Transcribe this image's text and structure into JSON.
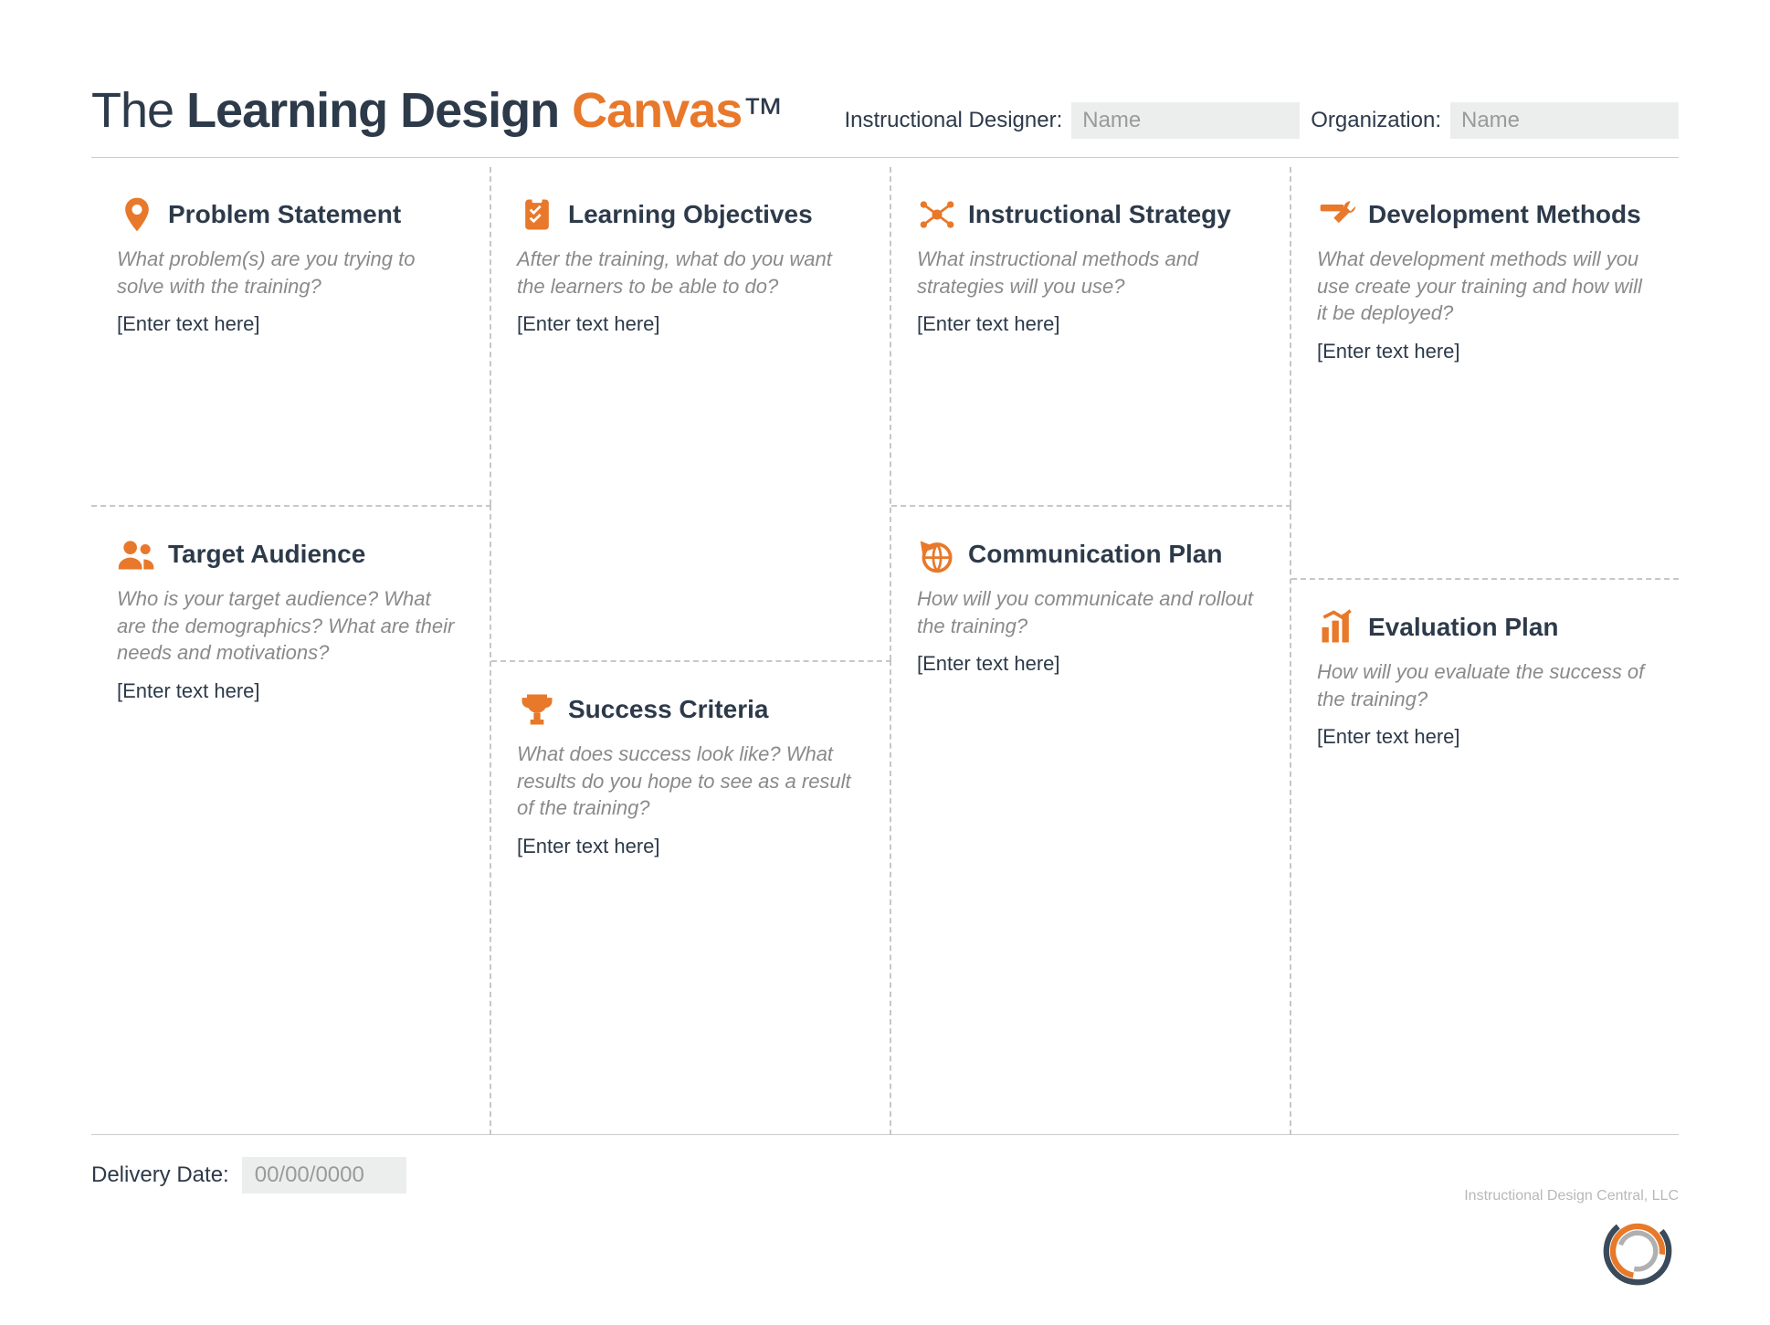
{
  "header": {
    "title_pre": "The ",
    "title_mid": "Learning Design ",
    "title_accent": "Canvas",
    "title_tm": "™",
    "designer_label": "Instructional Designer:",
    "designer_placeholder": "Name",
    "org_label": "Organization:",
    "org_placeholder": "Name"
  },
  "cells": {
    "problem": {
      "title": "Problem Statement",
      "prompt": "What problem(s) are you trying to solve with the training?",
      "entry": "[Enter text here]"
    },
    "audience": {
      "title": "Target Audience",
      "prompt": "Who is your target audience? What are the demographics? What are their needs and motivations?",
      "entry": "[Enter text here]"
    },
    "objectives": {
      "title": "Learning Objectives",
      "prompt": "After the training, what do you want the learners to be able to do?",
      "entry": "[Enter text here]"
    },
    "success": {
      "title": "Success Criteria",
      "prompt": "What does success look like? What results do you hope to see as a result of the training?",
      "entry": "[Enter text here]"
    },
    "strategy": {
      "title": "Instructional Strategy",
      "prompt": "What instructional methods and strategies will you use?",
      "entry": "[Enter text here]"
    },
    "communication": {
      "title": "Communication Plan",
      "prompt": "How will you communicate and rollout the training?",
      "entry": "[Enter text here]"
    },
    "development": {
      "title": "Development Methods",
      "prompt": "What development methods will you use create your training and how will it be deployed?",
      "entry": "[Enter text here]"
    },
    "evaluation": {
      "title": "Evaluation Plan",
      "prompt": "How will you evaluate the success of the training?",
      "entry": "[Enter text here]"
    }
  },
  "footer": {
    "delivery_label": "Delivery Date:",
    "delivery_placeholder": "00/00/0000",
    "copyright": "Instructional Design Central, LLC"
  }
}
